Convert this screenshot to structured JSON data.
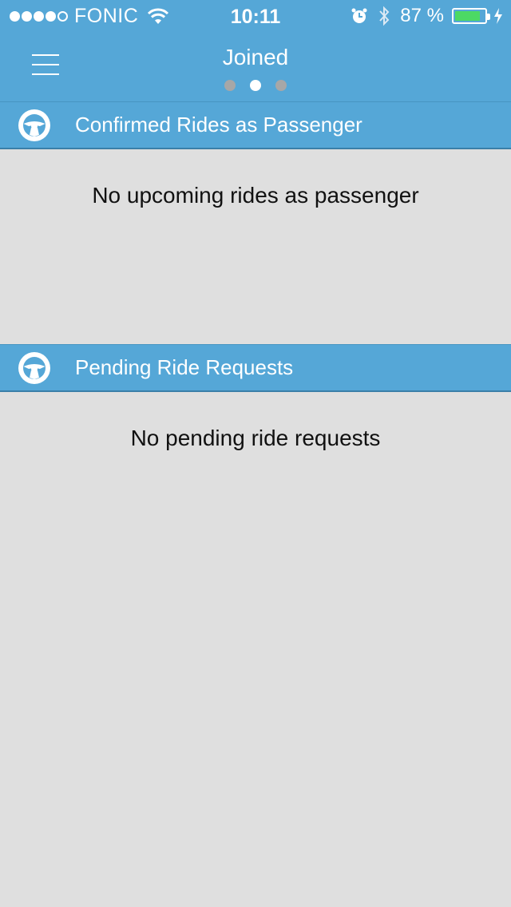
{
  "status_bar": {
    "carrier": "FONIC",
    "time": "10:11",
    "battery_text": "87 %",
    "battery_level": 0.87,
    "signal_bars": 4,
    "signal_total": 5,
    "icons": [
      "wifi-icon",
      "alarm-icon",
      "bluetooth-icon",
      "battery-icon",
      "charging-bolt-icon"
    ]
  },
  "nav": {
    "title": "Joined",
    "menu_icon": "hamburger-menu-icon",
    "page_count": 3,
    "active_page": 1
  },
  "sections": [
    {
      "title": "Confirmed Rides as Passenger",
      "icon": "steering-wheel-icon",
      "empty_message": "No upcoming rides as passenger"
    },
    {
      "title": "Pending Ride Requests",
      "icon": "steering-wheel-icon",
      "empty_message": "No pending ride requests"
    }
  ],
  "colors": {
    "header_blue": "#55a7d7",
    "background": "#dfdfdf",
    "battery_green": "#4cd964",
    "text": "#111111"
  }
}
